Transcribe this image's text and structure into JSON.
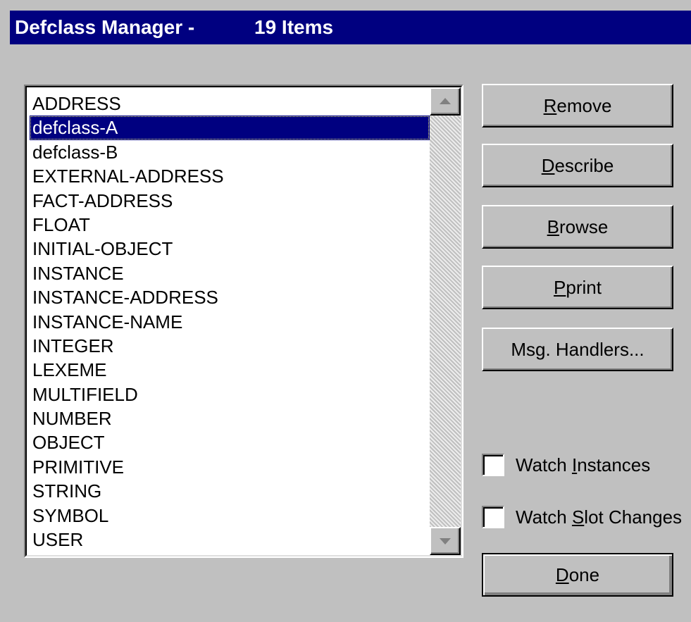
{
  "window": {
    "title_name": "Defclass Manager -",
    "title_count": "19 Items"
  },
  "classes": [
    "ADDRESS",
    "defclass-A",
    "defclass-B",
    "EXTERNAL-ADDRESS",
    "FACT-ADDRESS",
    "FLOAT",
    "INITIAL-OBJECT",
    "INSTANCE",
    "INSTANCE-ADDRESS",
    "INSTANCE-NAME",
    "INTEGER",
    "LEXEME",
    "MULTIFIELD",
    "NUMBER",
    "OBJECT",
    "PRIMITIVE",
    "STRING",
    "SYMBOL",
    "USER"
  ],
  "selected_index": 1,
  "buttons": {
    "remove": {
      "accel": "R",
      "rest": "emove"
    },
    "describe": {
      "accel": "D",
      "rest": "escribe"
    },
    "browse": {
      "accel": "B",
      "rest": "rowse"
    },
    "pprint": {
      "accel": "P",
      "rest": "print"
    },
    "msg_handlers": {
      "label": "Msg. Handlers..."
    },
    "done": {
      "accel": "D",
      "rest": "one"
    }
  },
  "checkboxes": {
    "watch_instances": {
      "pre": "Watch ",
      "accel": "I",
      "rest": "nstances",
      "checked": false
    },
    "watch_slot_changes": {
      "pre": "Watch ",
      "accel": "S",
      "rest": "lot Changes",
      "checked": false
    }
  },
  "icons": {
    "scroll_up": "scroll-up-arrow-icon",
    "scroll_down": "scroll-down-arrow-icon"
  },
  "colors": {
    "titlebar": "#000080",
    "selection": "#000080",
    "face": "#c0c0c0"
  }
}
